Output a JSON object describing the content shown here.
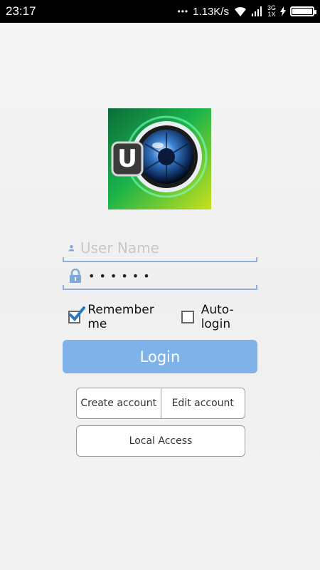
{
  "status_bar": {
    "time": "23:17",
    "notification_dots": "•••",
    "speed": "1.13K/s",
    "network_top": "3G",
    "network_bottom": "1X",
    "icons": [
      "wifi-icon",
      "signal-icon",
      "charging-icon",
      "battery-icon"
    ],
    "battery_level": 1.0
  },
  "logo": {
    "letter": "U",
    "icon": "camera-lens-icon"
  },
  "username": {
    "placeholder": "User Name",
    "value": "",
    "icon": "user-icon"
  },
  "password": {
    "masked_value": "••••••",
    "icon": "lock-icon"
  },
  "options": {
    "remember_me": {
      "label": "Remember me",
      "checked": true
    },
    "auto_login": {
      "label": "Auto-login",
      "checked": false
    }
  },
  "login_button": {
    "label": "Login"
  },
  "account_buttons": {
    "create": "Create account",
    "edit": "Edit account"
  },
  "local_access": {
    "label": "Local Access"
  },
  "colors": {
    "accent": "#7fb2e9",
    "underline": "#8fb0d8",
    "checkmark": "#2b78c2"
  }
}
